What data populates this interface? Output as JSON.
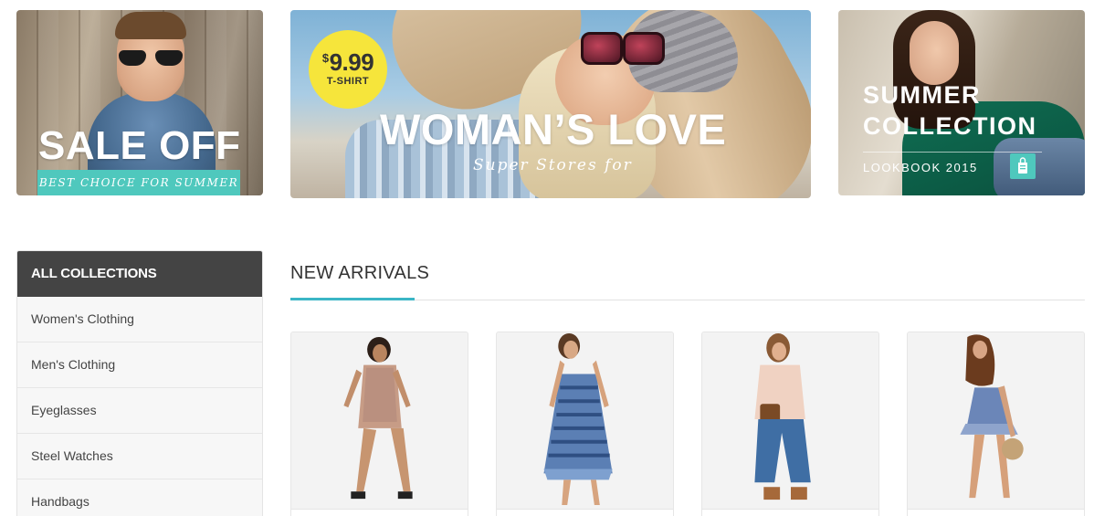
{
  "banners": {
    "sale": {
      "title": "SALE OFF",
      "strip": "BEST CHOICE FOR SUMMER"
    },
    "womans_love": {
      "price_currency": "$",
      "price_value": "9.99",
      "price_label": "T-SHIRT",
      "title": "WOMAN’S LOVE",
      "subtitle": "Super Stores for"
    },
    "summer": {
      "title_line1": "SUMMER",
      "title_line2": "COLLECTION",
      "lookbook": "LOOKBOOK 2015",
      "icon": "shopping-bag-icon"
    }
  },
  "sidebar": {
    "header": "ALL COLLECTIONS",
    "items": [
      {
        "label": "Women's Clothing"
      },
      {
        "label": "Men's Clothing"
      },
      {
        "label": "Eyeglasses"
      },
      {
        "label": "Steel Watches"
      },
      {
        "label": "Handbags"
      }
    ]
  },
  "new_arrivals": {
    "title": "NEW ARRIVALS",
    "accent_color": "#3bb6c6",
    "products": [
      {
        "image": "floral-romper-photo"
      },
      {
        "image": "blue-print-dress-photo"
      },
      {
        "image": "denim-culottes-jacket-photo"
      },
      {
        "image": "ruffle-sundress-photo"
      }
    ]
  },
  "colors": {
    "teal": "#4fc8bd",
    "badge_yellow": "#f6e53b",
    "sidebar_header": "#444444"
  }
}
